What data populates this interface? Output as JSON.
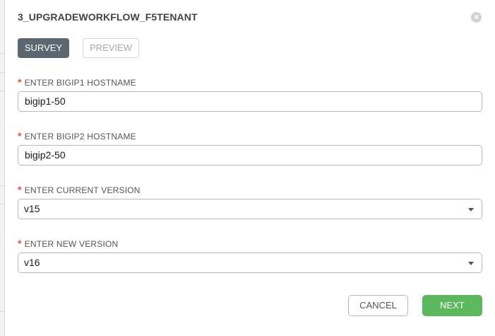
{
  "modal": {
    "title": "3_UPGRADEWORKFLOW_F5TENANT",
    "close_glyph": "×"
  },
  "tabs": [
    {
      "label": "SURVEY",
      "active": true
    },
    {
      "label": "PREVIEW",
      "active": false
    }
  ],
  "fields": [
    {
      "required_mark": "*",
      "label": "ENTER BIGIP1 HOSTNAME",
      "type": "text",
      "value": "bigip1-50"
    },
    {
      "required_mark": "*",
      "label": "ENTER BIGIP2 HOSTNAME",
      "type": "text",
      "value": "bigip2-50"
    },
    {
      "required_mark": "*",
      "label": "ENTER CURRENT VERSION",
      "type": "select",
      "value": "v15"
    },
    {
      "required_mark": "*",
      "label": "ENTER NEW VERSION",
      "type": "select",
      "value": "v16"
    }
  ],
  "buttons": {
    "cancel_label": "CANCEL",
    "next_label": "NEXT"
  },
  "colors": {
    "active_tab": "#5b6770",
    "next_button": "#5cb85c",
    "required_mark": "#d9534f"
  },
  "icons": {
    "close": "close-circle-icon",
    "dropdown": "caret-down-icon"
  }
}
